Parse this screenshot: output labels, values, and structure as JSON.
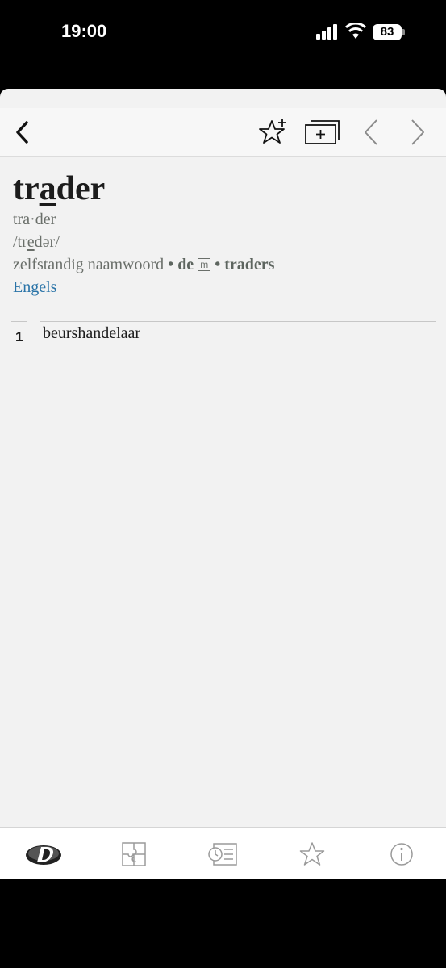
{
  "status_bar": {
    "time": "19:00",
    "battery": "83"
  },
  "toolbar": {
    "back_icon": "chevron-left-icon",
    "favorite_icon": "star-plus-icon",
    "flashcard_icon": "card-plus-icon",
    "previous_icon": "chevron-left-icon",
    "next_icon": "chevron-right-icon"
  },
  "entry": {
    "headword_pre": "tr",
    "headword_stress": "a",
    "headword_post": "der",
    "syllables": "tra·der",
    "pron_pre": "/tr",
    "pron_u": "e",
    "pron_post": "dər/",
    "pos": "zelfstandig naamwoord",
    "sep1": " • ",
    "article": "de",
    "gender": "m",
    "sep2": " • ",
    "plural": "traders",
    "language": "Engels"
  },
  "senses": [
    {
      "number": "1",
      "definition": "beurshandelaar"
    }
  ],
  "tabbar": {
    "items": [
      "dictionary-logo-icon",
      "puzzle-icon",
      "history-icon",
      "star-icon",
      "info-icon"
    ]
  }
}
